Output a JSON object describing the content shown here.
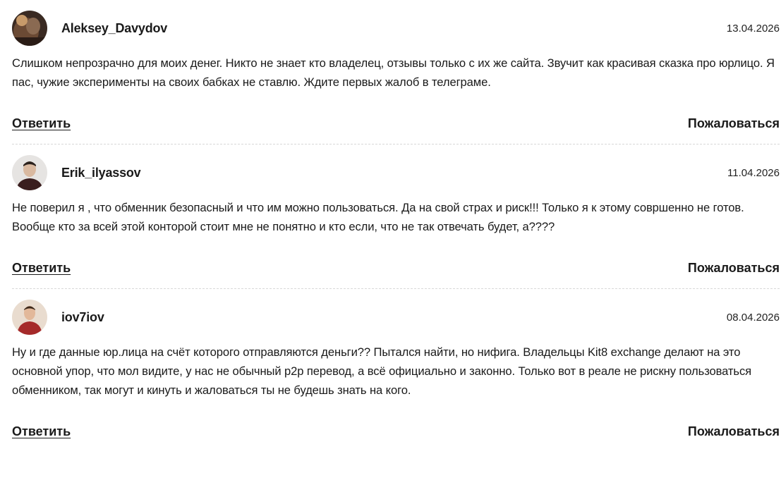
{
  "comments": [
    {
      "username": "Aleksey_Davydov",
      "date": "13.04.2026",
      "text": "Слишком непрозрачно для моих денег. Никто не знает кто владелец, отзывы только с их же сайта. Звучит как красивая сказка про юрлицо. Я пас, чужие эксперименты на своих бабках не ставлю. Ждите первых жалоб в телеграме.",
      "reply_label": "Ответить",
      "report_label": "Пожаловаться",
      "avatar_icon": "user-photo-avatar"
    },
    {
      "username": "Erik_ilyassov",
      "date": "11.04.2026",
      "text": "Не поверил я , что обменник безопасный и что им можно пользоваться. Да на свой страх и риск!!! Только я к этому совршенно не готов. Вообще кто за всей этой конторой стоит мне не понятно и кто если, что не так отвечать будет, а????",
      "reply_label": "Ответить",
      "report_label": "Пожаловаться",
      "avatar_icon": "user-photo-avatar"
    },
    {
      "username": "iov7iov",
      "date": "08.04.2026",
      "text": "Ну и где данные юр.лица на счёт которого отправляются деньги?? Пытался найти, но нифига. Владельцы Kit8 exchange делают на это основной упор, что мол видите, у нас не обычный p2p перевод, а всё официально и законно. Только вот в реале не рискну пользоваться обменником, так могут и кинуть и жаловаться ты не будешь знать на кого.",
      "reply_label": "Ответить",
      "report_label": "Пожаловаться",
      "avatar_icon": "user-photo-avatar"
    }
  ]
}
